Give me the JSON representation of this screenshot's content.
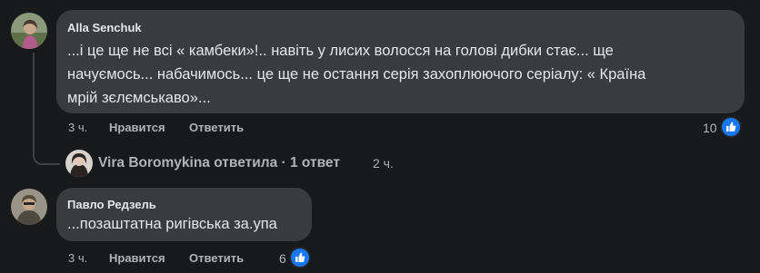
{
  "comments": [
    {
      "author": "Alla Senchuk",
      "text_lines": [
        "...і це ще не всі « камбеки»!.. навіть у лисих волосся на голові дибки стає... ще",
        "начуємось... набачимось... це ще не остання серія захоплюючого серіалу: « Країна",
        "мрій зєлємськаво»..."
      ],
      "time": "3 ч.",
      "like_label": "Нравится",
      "reply_label": "Ответить",
      "like_count": "10",
      "replies": {
        "summary": "Vira Boromykina ответила · 1 ответ",
        "time": "2 ч."
      }
    },
    {
      "author": "Павло Редзель",
      "text_lines": [
        "...позаштатна ригівська за.упа"
      ],
      "time": "3 ч.",
      "like_label": "Нравится",
      "reply_label": "Ответить",
      "like_count": "6"
    }
  ],
  "colors": {
    "background": "#18191a",
    "bubble": "#3a3b3c",
    "text": "#e4e6eb",
    "secondary_text": "#b0b3b8",
    "like_blue": "#1877f2"
  }
}
